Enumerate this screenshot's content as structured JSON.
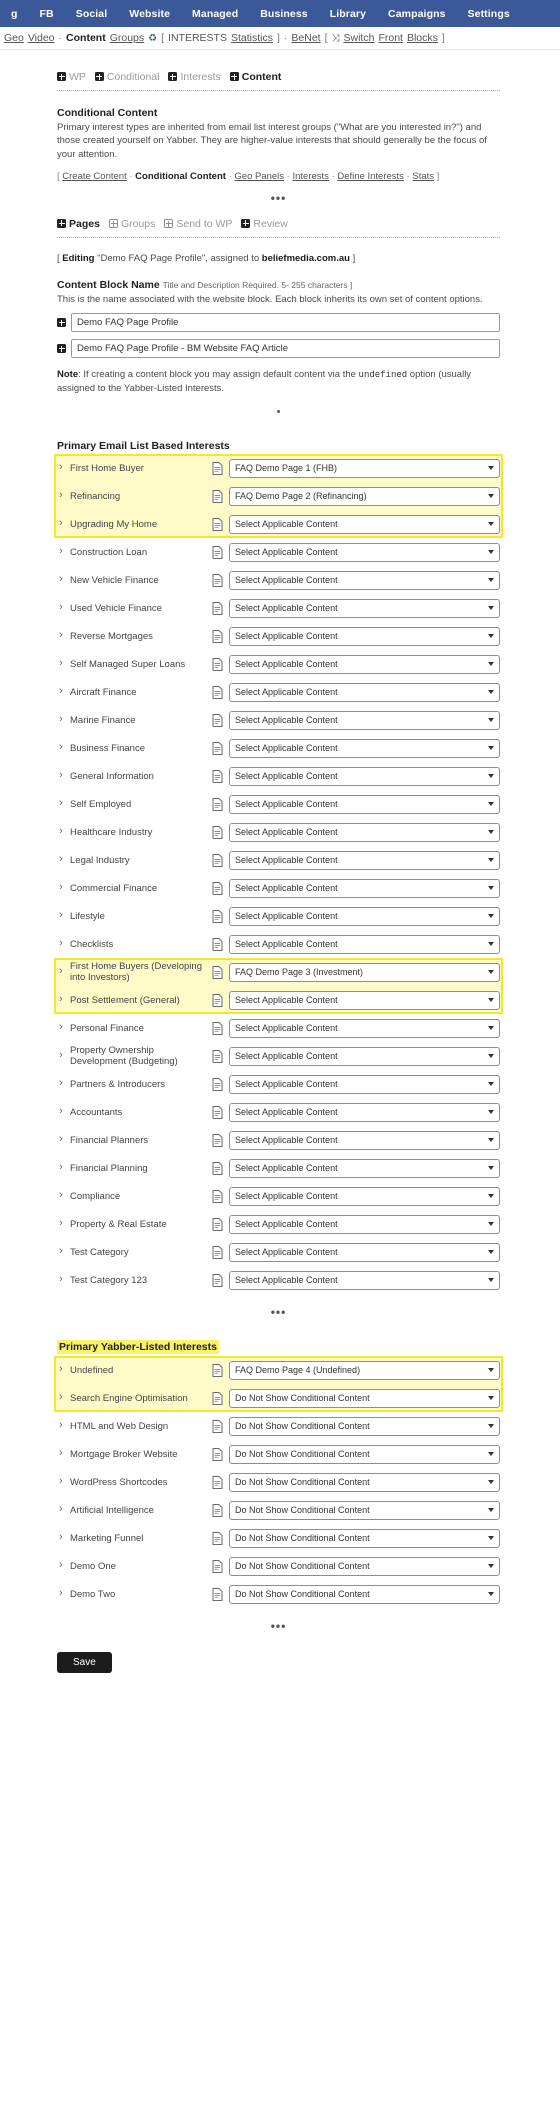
{
  "topnav": {
    "items": [
      "g",
      "FB",
      "Social",
      "Website",
      "Managed",
      "Business",
      "Library",
      "Campaigns",
      "Settings"
    ],
    "bg": "#3b5998"
  },
  "breadcrumb": {
    "parts": [
      {
        "text": "Geo",
        "style": "link"
      },
      {
        "text": "Video",
        "style": "link"
      },
      {
        "text": "·",
        "style": "sep"
      },
      {
        "text": "Content",
        "style": "bold"
      },
      {
        "text": "Groups",
        "style": "link"
      },
      {
        "text": "♻",
        "style": "icon-recycle"
      },
      {
        "text": "[",
        "style": "sep"
      },
      {
        "text": "INTERESTS",
        "style": "plain"
      },
      {
        "text": "Statistics",
        "style": "link"
      },
      {
        "text": "]",
        "style": "sep"
      },
      {
        "text": "·",
        "style": "sep"
      },
      {
        "text": "BeNet",
        "style": "link"
      },
      {
        "text": "[",
        "style": "sep"
      },
      {
        "text": "⤨",
        "style": "icon-switch"
      },
      {
        "text": "Switch",
        "style": "link"
      },
      {
        "text": "Front",
        "style": "link"
      },
      {
        "text": "Blocks",
        "style": "link"
      },
      {
        "text": "]",
        "style": "sep"
      }
    ]
  },
  "tabs_top": [
    {
      "label": "WP",
      "active": false,
      "icon": "plus-box-icon"
    },
    {
      "label": "Conditional",
      "active": false,
      "icon": "plus-box-icon"
    },
    {
      "label": "Interests",
      "active": false,
      "icon": "plus-box-icon"
    },
    {
      "label": "Content",
      "active": true,
      "icon": "plus-box-icon"
    }
  ],
  "conditional": {
    "title": "Conditional Content",
    "body": "Primary interest types are inherited from email list interest groups (\"What are you interested in?\") and those created yourself on Yabber. They are higher-value interests that should generally be the focus of your attention.",
    "links_open": "[",
    "links_close": "]",
    "links": [
      {
        "text": "Create Content",
        "bold": false
      },
      {
        "text": "Conditional Content",
        "bold": true
      },
      {
        "text": "Geo Panels",
        "bold": false
      },
      {
        "text": "Interests",
        "bold": false
      },
      {
        "text": "Define Interests",
        "bold": false
      },
      {
        "text": "Stats",
        "bold": false
      }
    ]
  },
  "ellipsis": "•••",
  "tabs_pages": [
    {
      "label": "Pages",
      "active": true,
      "icon": "plus-box-icon"
    },
    {
      "label": "Groups",
      "active": false,
      "icon": "plus-box-light-icon"
    },
    {
      "label": "Send to WP",
      "active": false,
      "icon": "plus-box-light-icon"
    },
    {
      "label": "Review",
      "active": false,
      "icon": "plus-box-icon"
    }
  ],
  "editing": {
    "prefix": "[ ",
    "label": "Editing",
    "target": " \"Demo FAQ Page Profile\", assigned to ",
    "domain": "beliefmedia.com.au",
    "suffix": " ]"
  },
  "block": {
    "heading": "Content Block Name",
    "heading_sub": "Title and Description Required. 5- 255 characters ]",
    "description": "This is the name associated with the website block. Each block inherits its own set of content options.",
    "fields": [
      {
        "name": "block-title-input",
        "value": "Demo FAQ Page Profile",
        "placeholder": "Content Block Name"
      },
      {
        "name": "block-description-input",
        "value": "Demo FAQ Page Profile - BM Website FAQ Article",
        "placeholder": "Description"
      }
    ],
    "note_label": "Note",
    "note_text": ": If creating a content block you may assign default content via the ",
    "note_code": "undefined",
    "note_text2": " option (usually assigned to the Yabber-Listed Interests."
  },
  "bullet": "•",
  "primary_email": {
    "title": "Primary Email List Based Interests",
    "default_option": "Select Applicable Content",
    "rows": [
      {
        "label": "First Home Buyer",
        "value": "FAQ Demo Page 1 (FHB)",
        "highlight": true
      },
      {
        "label": "Refinancing",
        "value": "FAQ Demo Page 2 (Refinancing)",
        "highlight": true
      },
      {
        "label": "Upgrading My Home",
        "value": "Select Applicable Content",
        "highlight": true
      },
      {
        "label": "Construction Loan",
        "value": "Select Applicable Content",
        "highlight": false
      },
      {
        "label": "New Vehicle Finance",
        "value": "Select Applicable Content",
        "highlight": false
      },
      {
        "label": "Used Vehicle Finance",
        "value": "Select Applicable Content",
        "highlight": false
      },
      {
        "label": "Reverse Mortgages",
        "value": "Select Applicable Content",
        "highlight": false
      },
      {
        "label": "Self Managed Super Loans",
        "value": "Select Applicable Content",
        "highlight": false
      },
      {
        "label": "Aircraft Finance",
        "value": "Select Applicable Content",
        "highlight": false
      },
      {
        "label": "Marine Finance",
        "value": "Select Applicable Content",
        "highlight": false
      },
      {
        "label": "Business Finance",
        "value": "Select Applicable Content",
        "highlight": false
      },
      {
        "label": "General Information",
        "value": "Select Applicable Content",
        "highlight": false
      },
      {
        "label": "Self Employed",
        "value": "Select Applicable Content",
        "highlight": false
      },
      {
        "label": "Healthcare Industry",
        "value": "Select Applicable Content",
        "highlight": false
      },
      {
        "label": "Legal Industry",
        "value": "Select Applicable Content",
        "highlight": false
      },
      {
        "label": "Commercial Finance",
        "value": "Select Applicable Content",
        "highlight": false
      },
      {
        "label": "Lifestyle",
        "value": "Select Applicable Content",
        "highlight": false
      },
      {
        "label": "Checklists",
        "value": "Select Applicable Content",
        "highlight": false
      },
      {
        "label": "First Home Buyers (Developing into Investors)",
        "value": "FAQ Demo Page 3 (Investment)",
        "highlight": true
      },
      {
        "label": "Post Settlement (General)",
        "value": "Select Applicable Content",
        "highlight": true
      },
      {
        "label": "Personal Finance",
        "value": "Select Applicable Content",
        "highlight": false
      },
      {
        "label": "Property Ownership Development (Budgeting)",
        "value": "Select Applicable Content",
        "highlight": false
      },
      {
        "label": "Partners & Introducers",
        "value": "Select Applicable Content",
        "highlight": false
      },
      {
        "label": "Accountants",
        "value": "Select Applicable Content",
        "highlight": false
      },
      {
        "label": "Financial Planners",
        "value": "Select Applicable Content",
        "highlight": false
      },
      {
        "label": "Financial Planning",
        "value": "Select Applicable Content",
        "highlight": false
      },
      {
        "label": "Compliance",
        "value": "Select Applicable Content",
        "highlight": false
      },
      {
        "label": "Property & Real Estate",
        "value": "Select Applicable Content",
        "highlight": false
      },
      {
        "label": "Test Category",
        "value": "Select Applicable Content",
        "highlight": false
      },
      {
        "label": "Test Category 123",
        "value": "Select Applicable Content",
        "highlight": false
      }
    ]
  },
  "primary_yabber": {
    "title": "Primary Yabber-Listed Interests",
    "default_option": "Do Not Show Conditional Content",
    "rows": [
      {
        "label": "Undefined",
        "value": "FAQ Demo Page 4 (Undefined)",
        "highlight": true
      },
      {
        "label": "Search Engine Optimisation",
        "value": "Do Not Show Conditional Content",
        "highlight": true
      },
      {
        "label": "HTML and Web Design",
        "value": "Do Not Show Conditional Content",
        "highlight": false
      },
      {
        "label": "Mortgage Broker Website",
        "value": "Do Not Show Conditional Content",
        "highlight": false
      },
      {
        "label": "WordPress Shortcodes",
        "value": "Do Not Show Conditional Content",
        "highlight": false
      },
      {
        "label": "Artificial Intelligence",
        "value": "Do Not Show Conditional Content",
        "highlight": false
      },
      {
        "label": "Marketing Funnel",
        "value": "Do Not Show Conditional Content",
        "highlight": false
      },
      {
        "label": "Demo One",
        "value": "Do Not Show Conditional Content",
        "highlight": false
      },
      {
        "label": "Demo Two",
        "value": "Do Not Show Conditional Content",
        "highlight": false
      }
    ]
  },
  "save": {
    "label": "Save"
  },
  "colors": {
    "nav_bg": "#3b5998",
    "highlight": "#fbf26a",
    "save_bg": "#1c1c1c"
  }
}
